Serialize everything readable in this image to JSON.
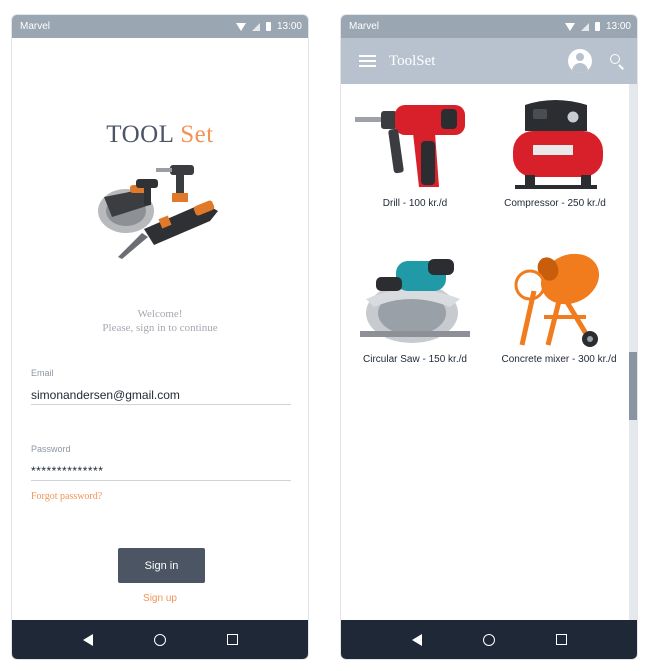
{
  "left_screen": {
    "status": {
      "carrier": "Marvel",
      "time": "13:00"
    },
    "logo": {
      "part1": "TOOL",
      "part2": "Set"
    },
    "welcome": {
      "line1": "Welcome!",
      "line2": "Please, sign in to continue"
    },
    "email": {
      "label": "Email",
      "value": "simonandersen@gmail.com"
    },
    "password": {
      "label": "Password",
      "value": "**************"
    },
    "forgot_label": "Forgot password?",
    "signin_label": "Sign in",
    "signup_label": "Sign up"
  },
  "right_screen": {
    "status": {
      "carrier": "Marvel",
      "time": "13:00"
    },
    "appbar": {
      "title": "ToolSet",
      "menu_icon": "menu-icon",
      "profile_icon": "avatar-icon",
      "search_icon": "search-icon"
    },
    "tools": [
      {
        "label": "Drill - 100 kr./d"
      },
      {
        "label": "Compressor - 250 kr./d"
      },
      {
        "label": "Circular Saw - 150 kr./d"
      },
      {
        "label": "Concrete mixer - 300 kr./d"
      }
    ]
  },
  "colors": {
    "status_bar": "#9ba6b3",
    "app_bar": "#b8c2ce",
    "nav_bar": "#1e2836",
    "accent_orange": "#f39359",
    "button": "#4b5563"
  }
}
